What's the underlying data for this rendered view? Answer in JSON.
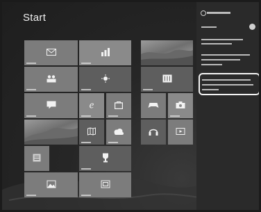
{
  "start": {
    "title": "Start"
  },
  "tiles": [
    {
      "name": "mail-tile",
      "icon": "mail-icon"
    },
    {
      "name": "finance-tile",
      "icon": "chart-icon"
    },
    {
      "name": "people-tile",
      "icon": "people-icon"
    },
    {
      "name": "weather-tile",
      "icon": "sun-icon"
    },
    {
      "name": "messaging-tile",
      "icon": "chat-bubble-icon"
    },
    {
      "name": "internet-explorer-tile",
      "icon": "internet-explorer-icon"
    },
    {
      "name": "store-tile",
      "icon": "shopping-bag-icon"
    },
    {
      "name": "maps-tile",
      "icon": "map-icon"
    },
    {
      "name": "skydrive-tile",
      "icon": "cloud-icon"
    },
    {
      "name": "desktop-tile",
      "icon": "landscape-photo"
    },
    {
      "name": "sports-tile",
      "icon": "trophy-icon"
    },
    {
      "name": "photos-tile",
      "icon": "picture-icon"
    },
    {
      "name": "video-tile",
      "icon": "film-icon"
    },
    {
      "name": "games-tile",
      "icon": "game-controller-icon"
    },
    {
      "name": "camera-tile",
      "icon": "camera-icon"
    },
    {
      "name": "music-tile",
      "icon": "headphones-icon"
    },
    {
      "name": "media-tile",
      "icon": "play-icon"
    }
  ],
  "colors": {
    "background": "#262626",
    "tile": "#7c7c7c",
    "charm_panel": "#2a2a2a",
    "highlight": "#f4f4f4"
  }
}
